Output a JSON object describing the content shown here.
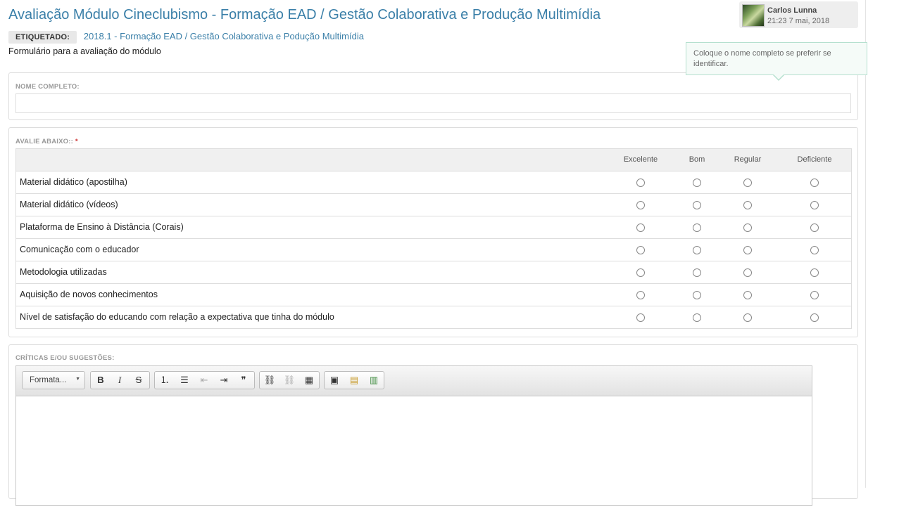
{
  "page": {
    "title": "Avaliação Módulo Cineclubismo - Formação EAD / Gestão Colaborativa e Produção Multimídia",
    "tag_label": "ETIQUETADO:",
    "tag_value": "2018.1 - Formação EAD / Gestão Colaborativa e Podução Multimídia",
    "description": "Formulário para a avaliação do módulo"
  },
  "author": {
    "name": "Carlos Lunna",
    "date": "21:23 7 mai, 2018"
  },
  "tooltip": {
    "text": "Coloque o nome completo se preferir se identificar."
  },
  "name_field": {
    "label": "NOME COMPLETO:",
    "value": "",
    "placeholder": ""
  },
  "rating": {
    "label": "AVALIE ABAIXO::",
    "required_mark": "*",
    "columns": [
      "Excelente",
      "Bom",
      "Regular",
      "Deficiente"
    ],
    "rows": [
      "Material didático (apostilha)",
      "Material didático (vídeos)",
      "Plataforma de Ensino à Distância (Corais)",
      "Comunicação com o educador",
      "Metodologia utilizadas",
      "Aquisição de novos conhecimentos",
      "Nível de satisfação do educando com relação a expectativa que tinha do módulo"
    ]
  },
  "comments": {
    "label": "CRÍTICAS E/OU SUGESTÕES:",
    "format_label": "Formata...",
    "format_arrow": "▼",
    "toolbar": {
      "bold": "B",
      "italic": "I",
      "strike": "S",
      "numbered_list": "⒈",
      "bulleted_list": "☰",
      "outdent": "⇤",
      "indent": "⇥",
      "blockquote": "❞",
      "link": "⛓",
      "unlink": "⛓",
      "table": "▦",
      "image": "▣",
      "gallery": "▤",
      "media": "▥"
    }
  }
}
